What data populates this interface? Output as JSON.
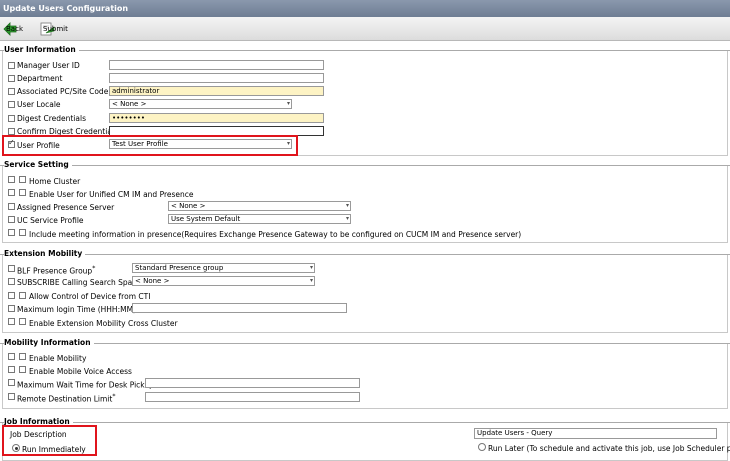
{
  "window": {
    "title": "Update Users Configuration"
  },
  "toolbar": {
    "back_label": "Back",
    "submit_label": "Submit"
  },
  "user_information": {
    "title": "User Information",
    "manager_user_id": {
      "label": "Manager User ID",
      "value": ""
    },
    "department": {
      "label": "Department",
      "value": ""
    },
    "associated_pc": {
      "label": "Associated PC/Site Code",
      "value": "administrator"
    },
    "user_locale": {
      "label": "User Locale",
      "value": "< None >"
    },
    "digest_credentials": {
      "label": "Digest Credentials",
      "value": "••••••••"
    },
    "confirm_digest": {
      "label": "Confirm Digest Credentials",
      "value": ""
    },
    "user_profile": {
      "label": "User Profile",
      "value": "Test User Profile"
    }
  },
  "service_setting": {
    "title": "Service Setting",
    "home_cluster": "Home Cluster",
    "enable_im": "Enable User for Unified CM IM and Presence",
    "assigned_presence": {
      "label": "Assigned Presence Server",
      "value": "< None >"
    },
    "uc_service": {
      "label": "UC Service Profile",
      "value": "Use System Default"
    },
    "include_meeting": "Include meeting information in presence(Requires Exchange Presence Gateway to be configured on CUCM IM and Presence server)"
  },
  "extension_mobility": {
    "title": "Extension Mobility",
    "blf_group": {
      "label": "BLF Presence Group",
      "required": "*",
      "value": "Standard Presence group"
    },
    "subscribe_css": {
      "label": "SUBSCRIBE Calling Search Space",
      "value": "< None >"
    },
    "allow_cti": "Allow Control of Device from CTI",
    "max_login": {
      "label": "Maximum login Time (HHH:MM)",
      "value": ""
    },
    "enable_em_cross": "Enable Extension Mobility Cross Cluster"
  },
  "mobility_information": {
    "title": "Mobility Information",
    "enable_mobility": "Enable Mobility",
    "enable_mva": "Enable Mobile Voice Access",
    "max_wait": {
      "label": "Maximum Wait Time for Desk Pickup",
      "required": "*",
      "value": ""
    },
    "remote_limit": {
      "label": "Remote Destination Limit",
      "required": "*",
      "value": ""
    }
  },
  "job_information": {
    "title": "Job Information",
    "job_description": {
      "label": "Job Description",
      "value": "Update Users - Query"
    },
    "run_immediately": "Run Immediately",
    "run_later": "Run Later (To schedule and activate this job, use Job Scheduler page.)"
  }
}
